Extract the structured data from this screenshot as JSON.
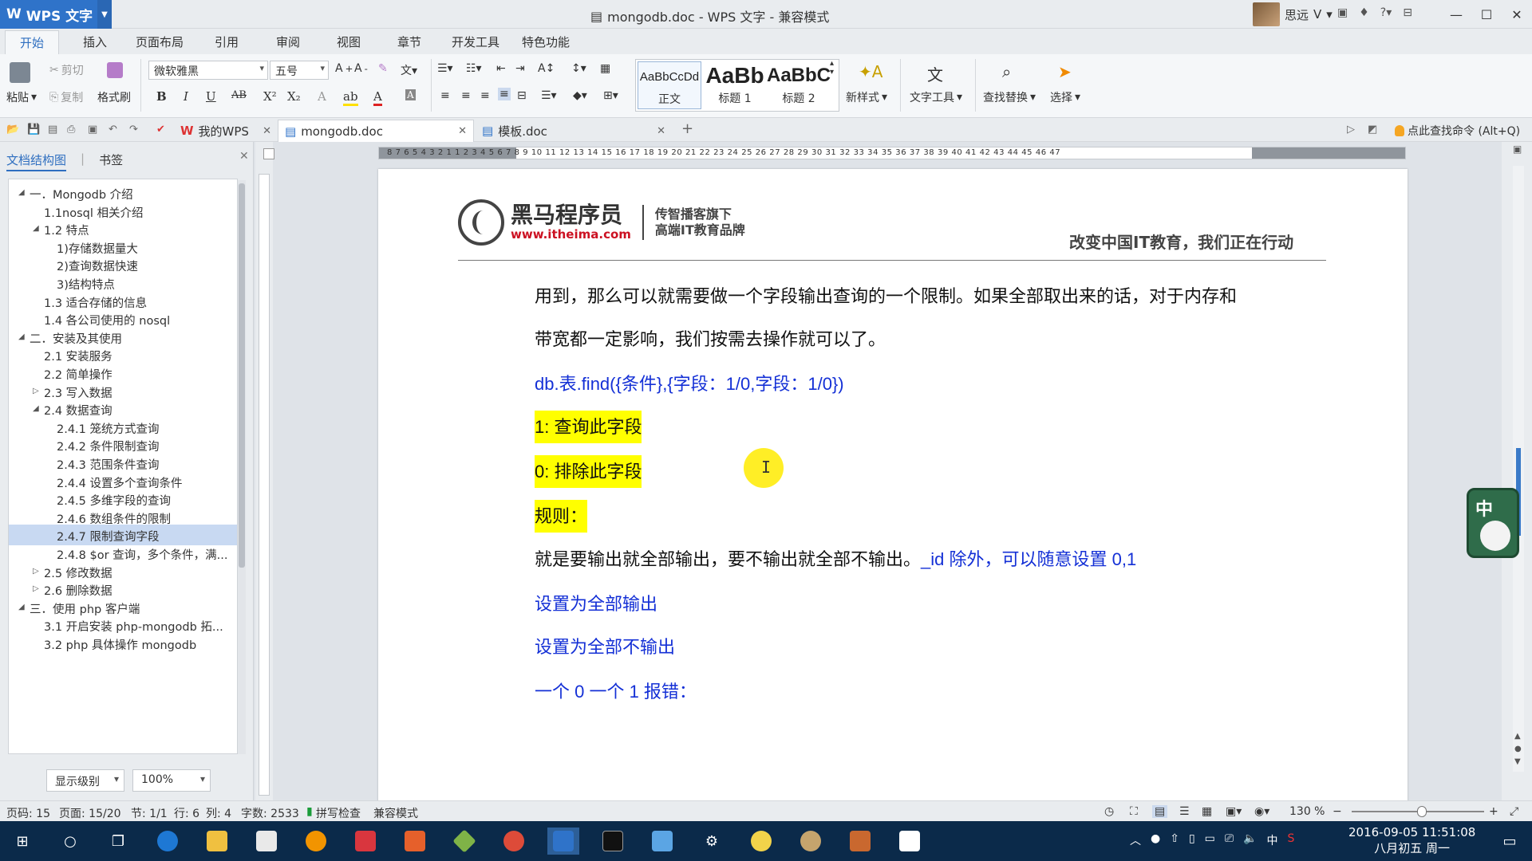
{
  "titlebar": {
    "app_name": "WPS 文字",
    "doc_title": "mongodb.doc - WPS 文字 - 兼容模式",
    "user_name": "思远",
    "window_controls": [
      "minimize-icon",
      "maximize-icon",
      "close-icon"
    ]
  },
  "menu_tabs": [
    "开始",
    "插入",
    "页面布局",
    "引用",
    "审阅",
    "视图",
    "章节",
    "开发工具",
    "特色功能"
  ],
  "ribbon": {
    "paste": "粘贴",
    "cut": "剪切",
    "copy": "复制",
    "format_painter": "格式刷",
    "font_name": "微软雅黑",
    "font_size": "五号",
    "styles": [
      {
        "preview": "AaBbCcDd",
        "name": "正文"
      },
      {
        "preview": "AaBb",
        "name": "标题 1"
      },
      {
        "preview": "AaBbC",
        "name": "标题 2"
      }
    ],
    "new_style": "新样式",
    "text_tools": "文字工具",
    "find_replace": "查找替换",
    "select": "选择",
    "accent_color": "#2f73c9"
  },
  "doc_tabs": [
    {
      "label": "我的WPS"
    },
    {
      "label": "mongodb.doc"
    },
    {
      "label": "模板.doc"
    }
  ],
  "find_command": "点此查找命令 (Alt+Q)",
  "nav": {
    "tabs": [
      "文档结构图",
      "书签"
    ],
    "items": [
      {
        "label": "一．Mongodb 介绍",
        "level": 0,
        "twisty": "▲"
      },
      {
        "label": "1.1nosql 相关介绍",
        "level": 1,
        "twisty": ""
      },
      {
        "label": "1.2 特点",
        "level": 1,
        "twisty": "▲"
      },
      {
        "label": "1)存储数据量大",
        "level": 2,
        "twisty": ""
      },
      {
        "label": "2)查询数据快速",
        "level": 2,
        "twisty": ""
      },
      {
        "label": "3)结构特点",
        "level": 2,
        "twisty": ""
      },
      {
        "label": "1.3 适合存储的信息",
        "level": 1,
        "twisty": ""
      },
      {
        "label": "1.4 各公司使用的 nosql",
        "level": 1,
        "twisty": ""
      },
      {
        "label": "二．安装及其使用",
        "level": 0,
        "twisty": "▲"
      },
      {
        "label": "2.1 安装服务",
        "level": 1,
        "twisty": ""
      },
      {
        "label": "2.2 简单操作",
        "level": 1,
        "twisty": ""
      },
      {
        "label": "2.3 写入数据",
        "level": 1,
        "twisty": "▷"
      },
      {
        "label": "2.4 数据查询",
        "level": 1,
        "twisty": "▲"
      },
      {
        "label": "2.4.1 笼统方式查询",
        "level": 2,
        "twisty": ""
      },
      {
        "label": "2.4.2 条件限制查询",
        "level": 2,
        "twisty": ""
      },
      {
        "label": "2.4.3 范围条件查询",
        "level": 2,
        "twisty": ""
      },
      {
        "label": "2.4.4 设置多个查询条件",
        "level": 2,
        "twisty": ""
      },
      {
        "label": "2.4.5 多维字段的查询",
        "level": 2,
        "twisty": ""
      },
      {
        "label": "2.4.6 数组条件的限制",
        "level": 2,
        "twisty": ""
      },
      {
        "label": "2.4.7 限制查询字段",
        "level": 2,
        "twisty": "",
        "selected": true
      },
      {
        "label": "2.4.8 $or 查询，多个条件，满...",
        "level": 2,
        "twisty": ""
      },
      {
        "label": "2.5 修改数据",
        "level": 1,
        "twisty": "▷"
      },
      {
        "label": "2.6 删除数据",
        "level": 1,
        "twisty": "▷"
      },
      {
        "label": "三．使用 php 客户端",
        "level": 0,
        "twisty": "▲"
      },
      {
        "label": "3.1 开启安装 php-mongodb 拓...",
        "level": 1,
        "twisty": ""
      },
      {
        "label": "3.2 php 具体操作 mongodb",
        "level": 1,
        "twisty": ""
      }
    ],
    "level_select": "显示级别",
    "zoom_select": "100%"
  },
  "ruler_labels": "8 7 6 5 4 3 2 1   1 2 3 4 5 6 7 8 9 10 11 12 13 14 15 16 17 18 19 20 21 22 23 24 25 26 27 28 29 30 31 32 33 34 35 36 37 38 39 40 41 42 43 44 45 46 47",
  "page_header": {
    "brand": "黑马程序员",
    "url": "www.itheima.com",
    "sub1": "传智播客旗下",
    "sub2": "高端IT教育品牌",
    "slogan": "改变中国IT教育，我们正在行动"
  },
  "content": {
    "p1": "用到，那么可以就需要做一个字段输出查询的一个限制。如果全部取出来的话，对于内存和",
    "p2": "带宽都一定影响，我们按需去操作就可以了。",
    "p3": "db.表.find({条件},{字段：1/0,字段：1/0})",
    "p4": "1:  查询此字段",
    "p5": "0:  排除此字段",
    "p6": "规则：",
    "p7_black": "就是要输出就全部输出，要不输出就全部不输出。",
    "p7_blue": "_id 除外，可以随意设置 0,1",
    "p8": "设置为全部输出",
    "p9": "设置为全部不输出",
    "p10": "一个 0 一个 1 报错："
  },
  "colors": {
    "highlight": "#ffff00",
    "blue_text": "#1430d6"
  },
  "statusbar": {
    "page_no": "页码: 15",
    "pages": "页面: 15/20",
    "section": "节: 1/1",
    "row": "行: 6",
    "col": "列: 4",
    "words": "字数: 2533",
    "spell": "拼写检查",
    "mode": "兼容模式",
    "zoom": "130 %"
  },
  "taskbar": {
    "date": "2016-09-05",
    "time": "11:51:08",
    "lunar": "八月初五 周一",
    "ime": "中"
  }
}
